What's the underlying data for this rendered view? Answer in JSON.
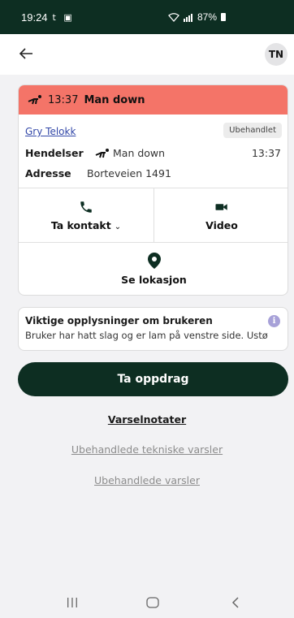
{
  "status_bar": {
    "time": "19:24",
    "notif_icons": "t ▣",
    "battery": "87%"
  },
  "app_bar": {
    "avatar_initials": "TN"
  },
  "alarm": {
    "time": "13:37",
    "type": "Man down",
    "user_name": "Gry Telokk",
    "status_badge": "Ubehandlet",
    "events_label": "Hendelser",
    "event_text": "Man down",
    "event_time": "13:37",
    "address_label": "Adresse",
    "address": "Borteveien 1491",
    "header_color": "#f47468"
  },
  "actions": {
    "contact": "Ta kontakt",
    "video": "Video",
    "location": "Se lokasjon"
  },
  "notice": {
    "title": "Viktige opplysninger om brukeren",
    "text": "Bruker har hatt slag og er lam på venstre side. Ustø"
  },
  "primary_button": "Ta oppdrag",
  "links": {
    "notes": "Varselnotater",
    "technical": "Ubehandlede tekniske varsler",
    "alerts": "Ubehandlede varsler"
  },
  "colors": {
    "brand_dark": "#0d2e22",
    "link_blue": "#3348a8",
    "info_purple": "#a7a1d8"
  }
}
